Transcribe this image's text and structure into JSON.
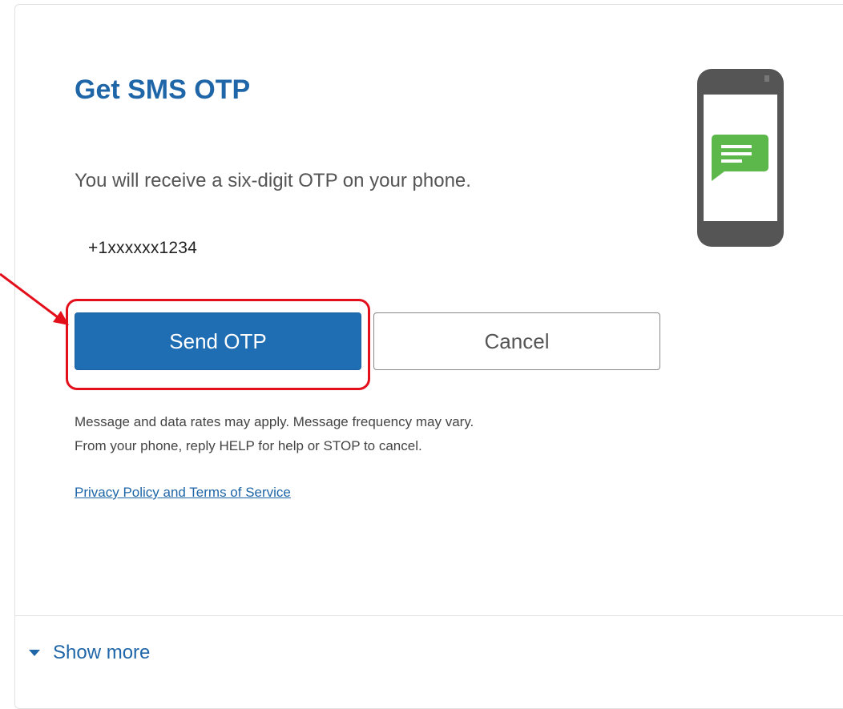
{
  "otp": {
    "title": "Get SMS OTP",
    "description": "You will receive a six-digit OTP on your phone.",
    "phone_number": "+1xxxxxx1234",
    "send_label": "Send OTP",
    "cancel_label": "Cancel",
    "disclaimer_line1": "Message and data rates may apply. Message frequency may vary.",
    "disclaimer_line2": "From your phone, reply HELP for help or STOP to cancel.",
    "policy_link": "Privacy Policy and Terms of Service",
    "show_more_label": "Show more"
  },
  "icons": {
    "illustration": "phone-with-message-icon",
    "show_more": "caret-down-icon"
  },
  "colors": {
    "accent": "#1f66a8",
    "primary_button": "#1f6db3",
    "message_bubble": "#5cb84a",
    "annotation": "#e3101c"
  }
}
